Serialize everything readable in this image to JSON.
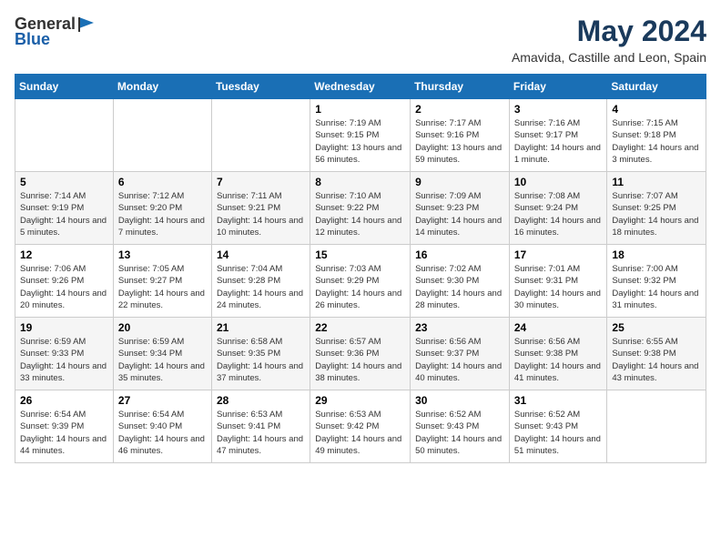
{
  "header": {
    "logo_general": "General",
    "logo_blue": "Blue",
    "month_title": "May 2024",
    "location": "Amavida, Castille and Leon, Spain"
  },
  "days_of_week": [
    "Sunday",
    "Monday",
    "Tuesday",
    "Wednesday",
    "Thursday",
    "Friday",
    "Saturday"
  ],
  "weeks": [
    [
      {
        "day": "",
        "info": ""
      },
      {
        "day": "",
        "info": ""
      },
      {
        "day": "",
        "info": ""
      },
      {
        "day": "1",
        "info": "Sunrise: 7:19 AM\nSunset: 9:15 PM\nDaylight: 13 hours and 56 minutes."
      },
      {
        "day": "2",
        "info": "Sunrise: 7:17 AM\nSunset: 9:16 PM\nDaylight: 13 hours and 59 minutes."
      },
      {
        "day": "3",
        "info": "Sunrise: 7:16 AM\nSunset: 9:17 PM\nDaylight: 14 hours and 1 minute."
      },
      {
        "day": "4",
        "info": "Sunrise: 7:15 AM\nSunset: 9:18 PM\nDaylight: 14 hours and 3 minutes."
      }
    ],
    [
      {
        "day": "5",
        "info": "Sunrise: 7:14 AM\nSunset: 9:19 PM\nDaylight: 14 hours and 5 minutes."
      },
      {
        "day": "6",
        "info": "Sunrise: 7:12 AM\nSunset: 9:20 PM\nDaylight: 14 hours and 7 minutes."
      },
      {
        "day": "7",
        "info": "Sunrise: 7:11 AM\nSunset: 9:21 PM\nDaylight: 14 hours and 10 minutes."
      },
      {
        "day": "8",
        "info": "Sunrise: 7:10 AM\nSunset: 9:22 PM\nDaylight: 14 hours and 12 minutes."
      },
      {
        "day": "9",
        "info": "Sunrise: 7:09 AM\nSunset: 9:23 PM\nDaylight: 14 hours and 14 minutes."
      },
      {
        "day": "10",
        "info": "Sunrise: 7:08 AM\nSunset: 9:24 PM\nDaylight: 14 hours and 16 minutes."
      },
      {
        "day": "11",
        "info": "Sunrise: 7:07 AM\nSunset: 9:25 PM\nDaylight: 14 hours and 18 minutes."
      }
    ],
    [
      {
        "day": "12",
        "info": "Sunrise: 7:06 AM\nSunset: 9:26 PM\nDaylight: 14 hours and 20 minutes."
      },
      {
        "day": "13",
        "info": "Sunrise: 7:05 AM\nSunset: 9:27 PM\nDaylight: 14 hours and 22 minutes."
      },
      {
        "day": "14",
        "info": "Sunrise: 7:04 AM\nSunset: 9:28 PM\nDaylight: 14 hours and 24 minutes."
      },
      {
        "day": "15",
        "info": "Sunrise: 7:03 AM\nSunset: 9:29 PM\nDaylight: 14 hours and 26 minutes."
      },
      {
        "day": "16",
        "info": "Sunrise: 7:02 AM\nSunset: 9:30 PM\nDaylight: 14 hours and 28 minutes."
      },
      {
        "day": "17",
        "info": "Sunrise: 7:01 AM\nSunset: 9:31 PM\nDaylight: 14 hours and 30 minutes."
      },
      {
        "day": "18",
        "info": "Sunrise: 7:00 AM\nSunset: 9:32 PM\nDaylight: 14 hours and 31 minutes."
      }
    ],
    [
      {
        "day": "19",
        "info": "Sunrise: 6:59 AM\nSunset: 9:33 PM\nDaylight: 14 hours and 33 minutes."
      },
      {
        "day": "20",
        "info": "Sunrise: 6:59 AM\nSunset: 9:34 PM\nDaylight: 14 hours and 35 minutes."
      },
      {
        "day": "21",
        "info": "Sunrise: 6:58 AM\nSunset: 9:35 PM\nDaylight: 14 hours and 37 minutes."
      },
      {
        "day": "22",
        "info": "Sunrise: 6:57 AM\nSunset: 9:36 PM\nDaylight: 14 hours and 38 minutes."
      },
      {
        "day": "23",
        "info": "Sunrise: 6:56 AM\nSunset: 9:37 PM\nDaylight: 14 hours and 40 minutes."
      },
      {
        "day": "24",
        "info": "Sunrise: 6:56 AM\nSunset: 9:38 PM\nDaylight: 14 hours and 41 minutes."
      },
      {
        "day": "25",
        "info": "Sunrise: 6:55 AM\nSunset: 9:38 PM\nDaylight: 14 hours and 43 minutes."
      }
    ],
    [
      {
        "day": "26",
        "info": "Sunrise: 6:54 AM\nSunset: 9:39 PM\nDaylight: 14 hours and 44 minutes."
      },
      {
        "day": "27",
        "info": "Sunrise: 6:54 AM\nSunset: 9:40 PM\nDaylight: 14 hours and 46 minutes."
      },
      {
        "day": "28",
        "info": "Sunrise: 6:53 AM\nSunset: 9:41 PM\nDaylight: 14 hours and 47 minutes."
      },
      {
        "day": "29",
        "info": "Sunrise: 6:53 AM\nSunset: 9:42 PM\nDaylight: 14 hours and 49 minutes."
      },
      {
        "day": "30",
        "info": "Sunrise: 6:52 AM\nSunset: 9:43 PM\nDaylight: 14 hours and 50 minutes."
      },
      {
        "day": "31",
        "info": "Sunrise: 6:52 AM\nSunset: 9:43 PM\nDaylight: 14 hours and 51 minutes."
      },
      {
        "day": "",
        "info": ""
      }
    ]
  ]
}
